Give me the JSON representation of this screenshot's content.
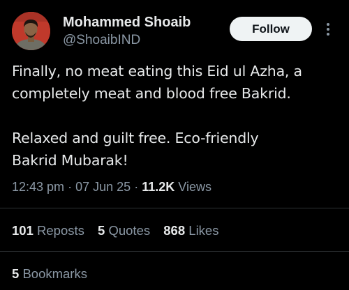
{
  "author": {
    "name": "Mohammed Shoaib",
    "handle": "@ShoaibIND"
  },
  "actions": {
    "follow_label": "Follow"
  },
  "tweet": {
    "lines": [
      "Finally, no meat eating this Eid ul Azha, a",
      "completely meat and blood free Bakrid.",
      "",
      "Relaxed and guilt free. Eco-friendly",
      "Bakrid Mubarak!"
    ],
    "time": "12:43 pm",
    "separator": "·",
    "date": "07 Jun 25",
    "views_count": "11.2K",
    "views_label": "Views"
  },
  "stats": {
    "reposts_count": "101",
    "reposts_label": "Reposts",
    "quotes_count": "5",
    "quotes_label": "Quotes",
    "likes_count": "868",
    "likes_label": "Likes",
    "bookmarks_count": "5",
    "bookmarks_label": "Bookmarks"
  },
  "colors": {
    "background": "#000000",
    "primary_text": "#e7e9ea",
    "secondary_text": "#8b98a5",
    "divider": "#2f3336",
    "follow_button_bg": "#eff3f4",
    "avatar_bg": "#c0392b"
  },
  "icons": {
    "more": "more-vertical-icon"
  }
}
